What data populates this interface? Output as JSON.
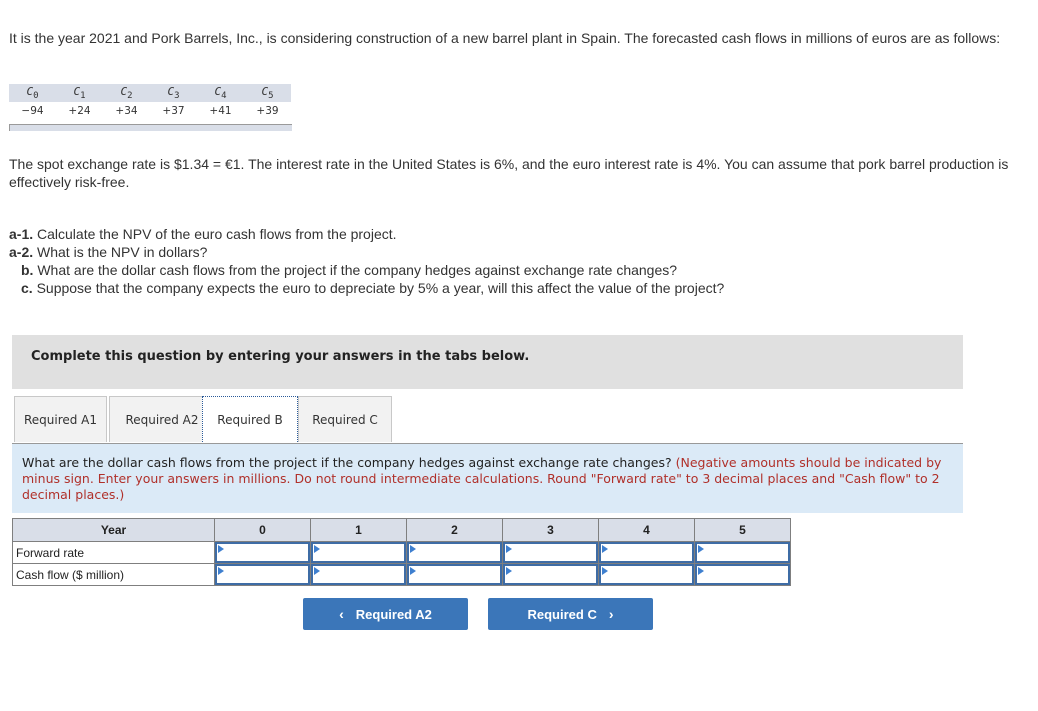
{
  "intro": "It is the year 2021 and Pork Barrels, Inc., is considering construction of a new barrel plant in Spain. The forecasted cash flows in millions of euros are as follows:",
  "cash_flows": {
    "headers": [
      {
        "base": "C",
        "sub": "0"
      },
      {
        "base": "C",
        "sub": "1"
      },
      {
        "base": "C",
        "sub": "2"
      },
      {
        "base": "C",
        "sub": "3"
      },
      {
        "base": "C",
        "sub": "4"
      },
      {
        "base": "C",
        "sub": "5"
      }
    ],
    "values": [
      "−94",
      "+24",
      "+34",
      "+37",
      "+41",
      "+39"
    ]
  },
  "spot_text": "The spot exchange rate is $1.34 = €1. The interest rate in the United States is 6%, and the euro interest rate is 4%. You can assume that pork barrel production is effectively risk-free.",
  "questions": [
    {
      "label": "a-1.",
      "text": " Calculate the NPV of the euro cash flows from the project."
    },
    {
      "label": "a-2.",
      "text": " What is the NPV in dollars?"
    },
    {
      "label": "b.",
      "text": " What are the dollar cash flows from the project if the company hedges against exchange rate changes?"
    },
    {
      "label": "c.",
      "text": " Suppose that the company expects the euro to depreciate by 5% a year, will this affect the value of the project?"
    }
  ],
  "instruction": "Complete this question by entering your answers in the tabs below.",
  "tabs": [
    {
      "label": "Required A1",
      "active": false
    },
    {
      "label": "Required A2",
      "active": false
    },
    {
      "label": "Required B",
      "active": true
    },
    {
      "label": "Required C",
      "active": false
    }
  ],
  "prompt": {
    "question": "What are the dollar cash flows from the project if the company hedges against exchange rate changes? ",
    "note": "(Negative amounts should be indicated by minus sign. Enter your answers in millions. Do not round intermediate calculations. Round \"Forward rate\" to 3 decimal places and \"Cash flow\" to 2 decimal places.)"
  },
  "answer_table": {
    "header_label": "Year",
    "years": [
      "0",
      "1",
      "2",
      "3",
      "4",
      "5"
    ],
    "rows": [
      {
        "label": "Forward rate",
        "values": [
          "",
          "",
          "",
          "",
          "",
          ""
        ]
      },
      {
        "label": "Cash flow ($ million)",
        "values": [
          "",
          "",
          "",
          "",
          "",
          ""
        ]
      }
    ]
  },
  "nav": {
    "prev_label": "Required A2",
    "prev_icon": "chevron-left-icon",
    "next_label": "Required C",
    "next_icon": "chevron-right-icon"
  },
  "colors": {
    "button_blue": "#3b76b9",
    "prompt_bg": "#dbeaf7",
    "note_red": "#b0302a",
    "instruction_bg": "#e0e0e0"
  }
}
